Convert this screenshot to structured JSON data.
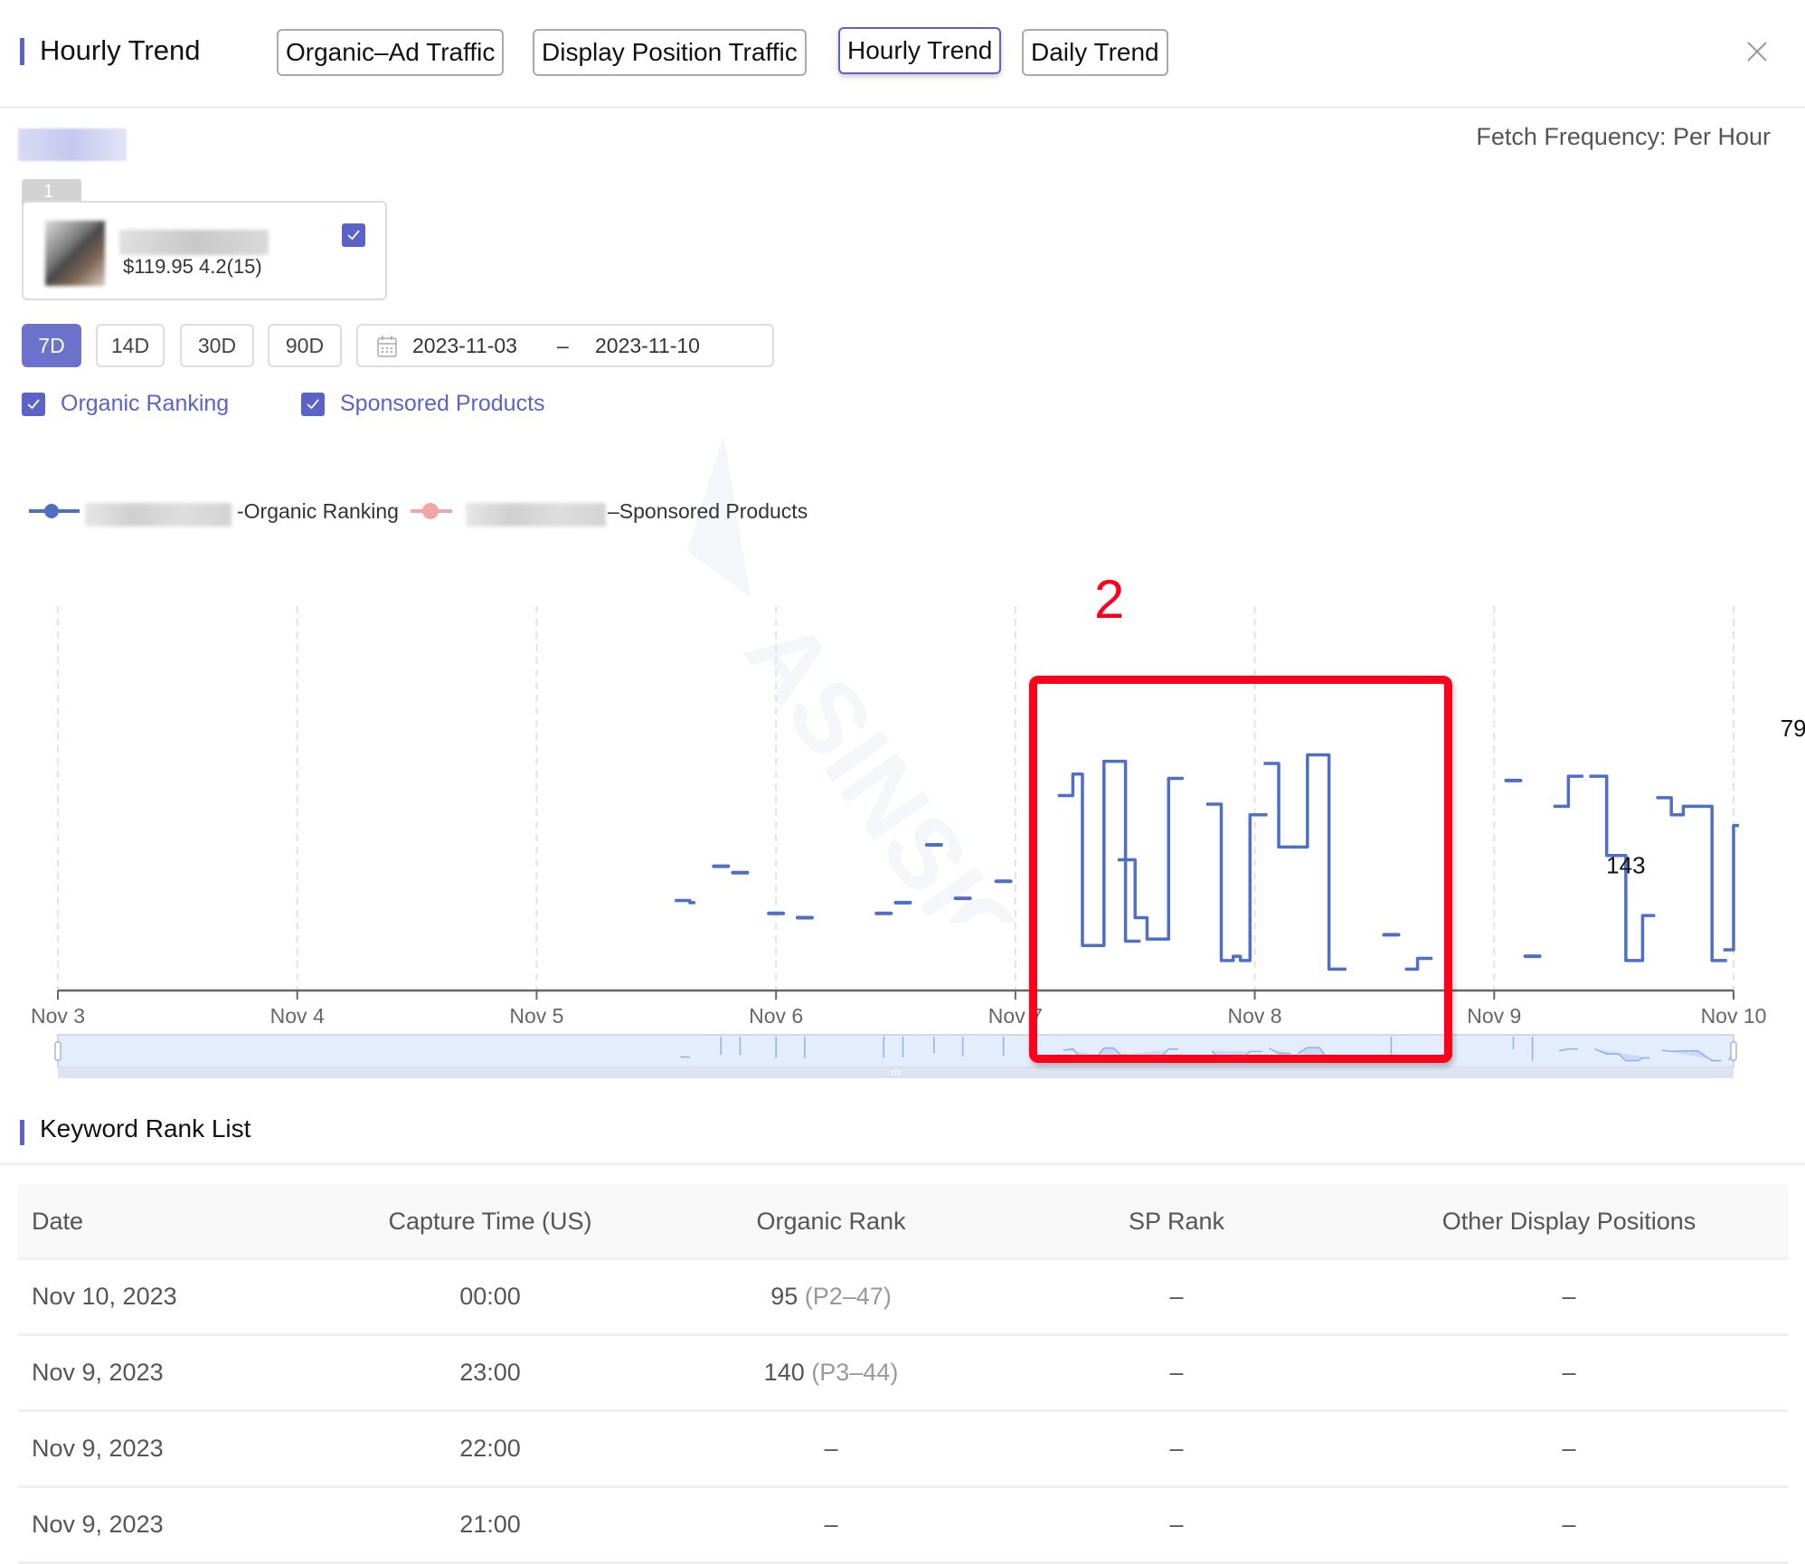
{
  "header": {
    "title": "Hourly Trend",
    "tabs": [
      {
        "label": "Organic–Ad Traffic",
        "active": false
      },
      {
        "label": "Display Position Traffic",
        "active": false
      },
      {
        "label": "Hourly Trend",
        "active": true
      },
      {
        "label": "Daily Trend",
        "active": false
      }
    ],
    "close_icon": "close-icon"
  },
  "fetch_frequency": "Fetch Frequency: Per Hour",
  "product_card": {
    "index": "1",
    "price_rating": "$119.95 4.2(15)",
    "selected": true
  },
  "date_range": {
    "buttons": [
      {
        "label": "7D",
        "active": true
      },
      {
        "label": "14D",
        "active": false
      },
      {
        "label": "30D",
        "active": false
      },
      {
        "label": "90D",
        "active": false
      }
    ],
    "start": "2023-11-03",
    "separator": "–",
    "end": "2023-11-10",
    "icon": "calendar-icon"
  },
  "filters": [
    {
      "label": "Organic Ranking",
      "checked": true
    },
    {
      "label": "Sponsored Products",
      "checked": true
    }
  ],
  "legend": [
    {
      "label": "-Organic Ranking",
      "color": "#4f6fc6"
    },
    {
      "label": "–Sponsored Products",
      "color": "#f2a5a5"
    }
  ],
  "annotation": {
    "label": "2",
    "color": "#ff001a"
  },
  "chart_data": {
    "type": "line",
    "title": "",
    "xlabel": "",
    "ylabel": "",
    "x_ticks": [
      "Nov 3",
      "Nov 4",
      "Nov 5",
      "Nov 6",
      "Nov 7",
      "Nov 8",
      "Nov 9",
      "Nov 10"
    ],
    "x_range_days": [
      0,
      7
    ],
    "y_inverted": true,
    "ylim": [
      0,
      190
    ],
    "grid": "vertical-dashed",
    "legend_position": "top-left",
    "data_labels": [
      {
        "x": 7.25,
        "y": 79,
        "text": "79"
      },
      {
        "x": 6.55,
        "y": 143,
        "text": "143"
      }
    ],
    "series": [
      {
        "name": "Organic Ranking",
        "color": "#4f6fc6",
        "step": true,
        "segments": [
          [
            [
              2.6,
              148
            ],
            [
              2.64,
              149
            ]
          ],
          [
            [
              2.77,
              132
            ]
          ],
          [
            [
              2.85,
              135
            ]
          ],
          [
            [
              3.0,
              154
            ]
          ],
          [
            [
              3.12,
              156
            ]
          ],
          [
            [
              3.45,
              154
            ]
          ],
          [
            [
              3.53,
              149
            ]
          ],
          [
            [
              3.66,
              122
            ]
          ],
          [
            [
              3.78,
              147
            ]
          ],
          [
            [
              3.95,
              139
            ]
          ],
          [
            [
              4.2,
              99
            ],
            [
              4.24,
              89
            ],
            [
              4.28,
              169
            ],
            [
              4.33,
              169
            ],
            [
              4.37,
              83
            ],
            [
              4.41,
              83
            ],
            [
              4.46,
              167
            ],
            [
              4.5,
              167
            ]
          ],
          [
            [
              4.45,
              129
            ],
            [
              4.5,
              156
            ],
            [
              4.55,
              166
            ],
            [
              4.6,
              166
            ],
            [
              4.64,
              91
            ],
            [
              4.68,
              91
            ]
          ],
          [
            [
              4.82,
              103
            ],
            [
              4.86,
              176
            ],
            [
              4.91,
              174
            ],
            [
              4.94,
              176
            ],
            [
              4.98,
              108
            ],
            [
              5.03,
              108
            ]
          ],
          [
            [
              5.06,
              84
            ],
            [
              5.1,
              123
            ],
            [
              5.15,
              123
            ]
          ],
          [
            [
              5.18,
              123
            ],
            [
              5.22,
              80
            ],
            [
              5.27,
              80
            ],
            [
              5.31,
              180
            ],
            [
              5.36,
              180
            ]
          ],
          [
            [
              5.57,
              164
            ]
          ],
          [
            [
              5.65,
              180
            ],
            [
              5.68,
              175
            ],
            [
              5.72,
              175
            ]
          ],
          [
            [
              6.08,
              92
            ]
          ],
          [
            [
              6.16,
              174
            ]
          ],
          [
            [
              6.27,
              104
            ],
            [
              6.31,
              90
            ],
            [
              6.35,
              90
            ]
          ],
          [
            [
              6.42,
              90
            ],
            [
              6.47,
              127
            ],
            [
              6.52,
              127
            ],
            [
              6.55,
              176
            ],
            [
              6.6,
              176
            ],
            [
              6.62,
              155
            ],
            [
              6.65,
              155
            ]
          ],
          [
            [
              6.7,
              100
            ],
            [
              6.74,
              108
            ],
            [
              6.79,
              104
            ],
            [
              6.85,
              104
            ],
            [
              6.91,
              176
            ],
            [
              6.95,
              176
            ]
          ],
          [
            [
              6.98,
              171
            ],
            [
              7.0,
              113
            ]
          ]
        ]
      },
      {
        "name": "Sponsored Products",
        "color": "#f2a5a5",
        "segments": []
      }
    ]
  },
  "keyword_rank_list": {
    "title": "Keyword Rank List",
    "columns": [
      "Date",
      "Capture Time (US)",
      "Organic Rank",
      "SP Rank",
      "Other Display Positions"
    ],
    "rows": [
      {
        "date": "Nov 10, 2023",
        "time": "00:00",
        "organic": "95",
        "organic_sub": "(P2–47)",
        "sp": "–",
        "other": "–"
      },
      {
        "date": "Nov 9, 2023",
        "time": "23:00",
        "organic": "140",
        "organic_sub": "(P3–44)",
        "sp": "–",
        "other": "–"
      },
      {
        "date": "Nov 9, 2023",
        "time": "22:00",
        "organic": "–",
        "organic_sub": "",
        "sp": "–",
        "other": "–"
      },
      {
        "date": "Nov 9, 2023",
        "time": "21:00",
        "organic": "–",
        "organic_sub": "",
        "sp": "–",
        "other": "–"
      }
    ]
  }
}
